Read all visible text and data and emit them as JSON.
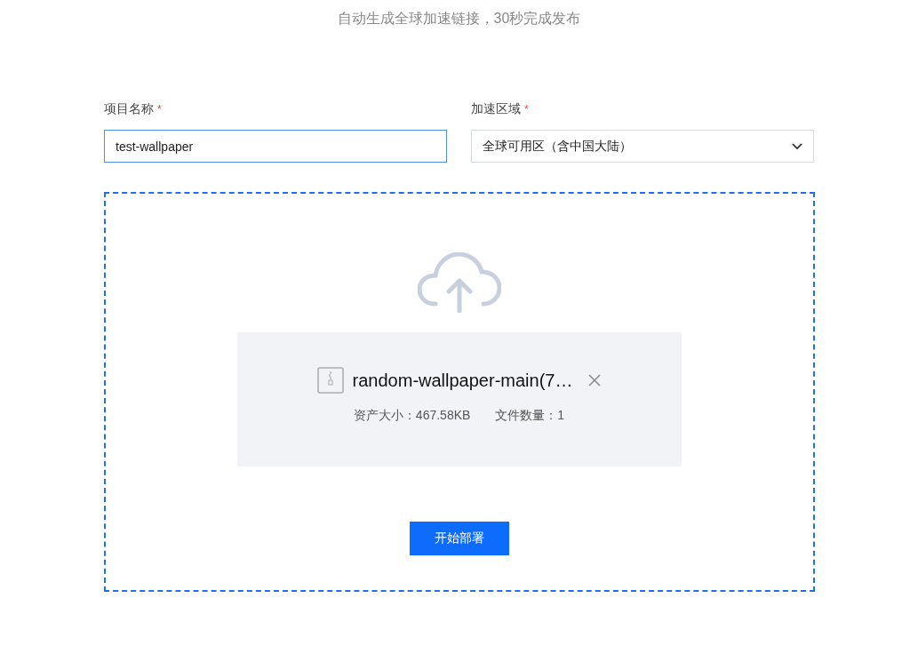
{
  "subtitle": "自动生成全球加速链接，30秒完成发布",
  "fields": [
    {
      "kind": "input",
      "label": "项目名称",
      "required_mark": "*",
      "value": "test-wallpaper"
    },
    {
      "kind": "select",
      "label": "加速区域",
      "required_mark": "*",
      "value": "全球可用区（含中国大陆）"
    }
  ],
  "upload": {
    "file": {
      "name": "random-wallpaper-main(7…",
      "size_label": "资产大小：467.58KB",
      "count_label": "文件数量：1"
    },
    "button": "开始部署"
  }
}
